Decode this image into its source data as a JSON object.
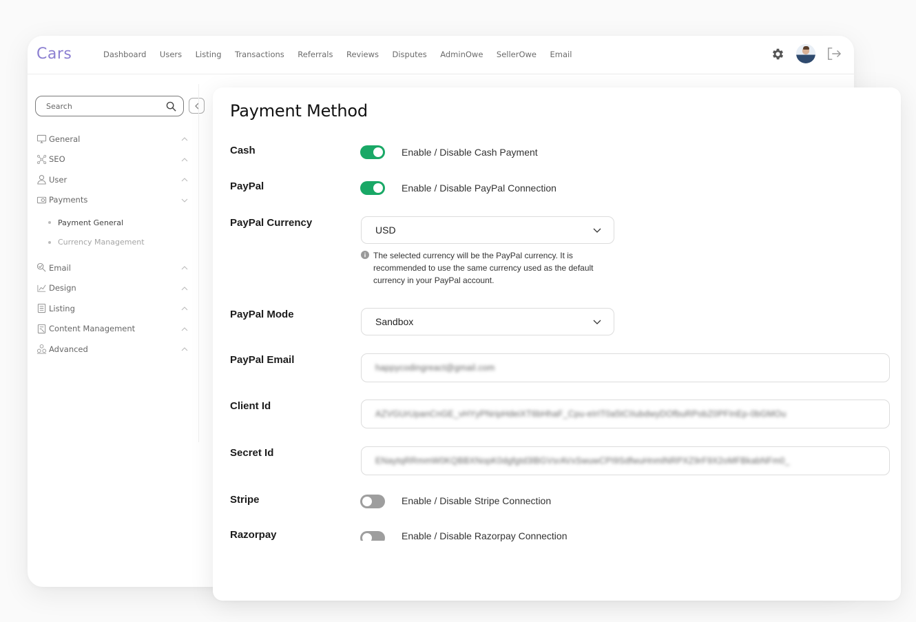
{
  "app": {
    "logo": "Cars",
    "nav": [
      "Dashboard",
      "Users",
      "Listing",
      "Transactions",
      "Referrals",
      "Reviews",
      "Disputes",
      "AdminOwe",
      "SellerOwe",
      "Email"
    ],
    "top_icons": [
      "gear-icon",
      "avatar",
      "logout-icon"
    ]
  },
  "sidebar": {
    "search_placeholder": "Search",
    "items": [
      {
        "label": "General",
        "icon": "monitor-icon",
        "expanded": false
      },
      {
        "label": "SEO",
        "icon": "network-icon",
        "expanded": false
      },
      {
        "label": "User",
        "icon": "user-icon",
        "expanded": false
      },
      {
        "label": "Payments",
        "icon": "wallet-icon",
        "expanded": true,
        "children": [
          {
            "label": "Payment General",
            "active": true
          },
          {
            "label": "Currency Management",
            "active": false
          }
        ]
      },
      {
        "label": "Email",
        "icon": "email-icon",
        "expanded": false
      },
      {
        "label": "Design",
        "icon": "design-icon",
        "expanded": false
      },
      {
        "label": "Listing",
        "icon": "list-icon",
        "expanded": false
      },
      {
        "label": "Content Management",
        "icon": "content-icon",
        "expanded": false
      },
      {
        "label": "Advanced",
        "icon": "advanced-icon",
        "expanded": false
      }
    ]
  },
  "payment": {
    "title": "Payment Method",
    "cash": {
      "label": "Cash",
      "enabled": true,
      "description": "Enable / Disable Cash Payment"
    },
    "paypal": {
      "label": "PayPal",
      "enabled": true,
      "description": "Enable / Disable PayPal Connection"
    },
    "paypal_currency": {
      "label": "PayPal Currency",
      "value": "USD",
      "help": "The selected currency will be the PayPal currency. It is recommended to use the same currency used as the default currency in your PayPal account."
    },
    "paypal_mode": {
      "label": "PayPal Mode",
      "value": "Sandbox"
    },
    "paypal_email": {
      "label": "PayPal Email",
      "value": "happycodingreact@gmail.com"
    },
    "client_id": {
      "label": "Client Id",
      "value": "AZVGUrUpanCnGE_vHYyPNripHdeiXT6bHhaF_Cpu-eIrIT0a5tCIIubdwyDOfbuRPobZ0PFInEp-0bGMOu"
    },
    "secret_id": {
      "label": "Secret Id",
      "value": "ENaytqRRmmW0KQBBXNopK0dgfgtd3lBGVsrAVxSwuwCPI9SdfwuHnmlNRPXZ9rF9X2oMFBkabNFm0_"
    },
    "stripe": {
      "label": "Stripe",
      "enabled": false,
      "description": "Enable / Disable Stripe Connection"
    },
    "razorpay": {
      "label": "Razorpay",
      "enabled": false,
      "description": "Enable / Disable Razorpay Connection"
    }
  },
  "colors": {
    "brand": "#8b7fd1",
    "toggle_on": "#19a866",
    "toggle_off": "#9e9e9e"
  }
}
